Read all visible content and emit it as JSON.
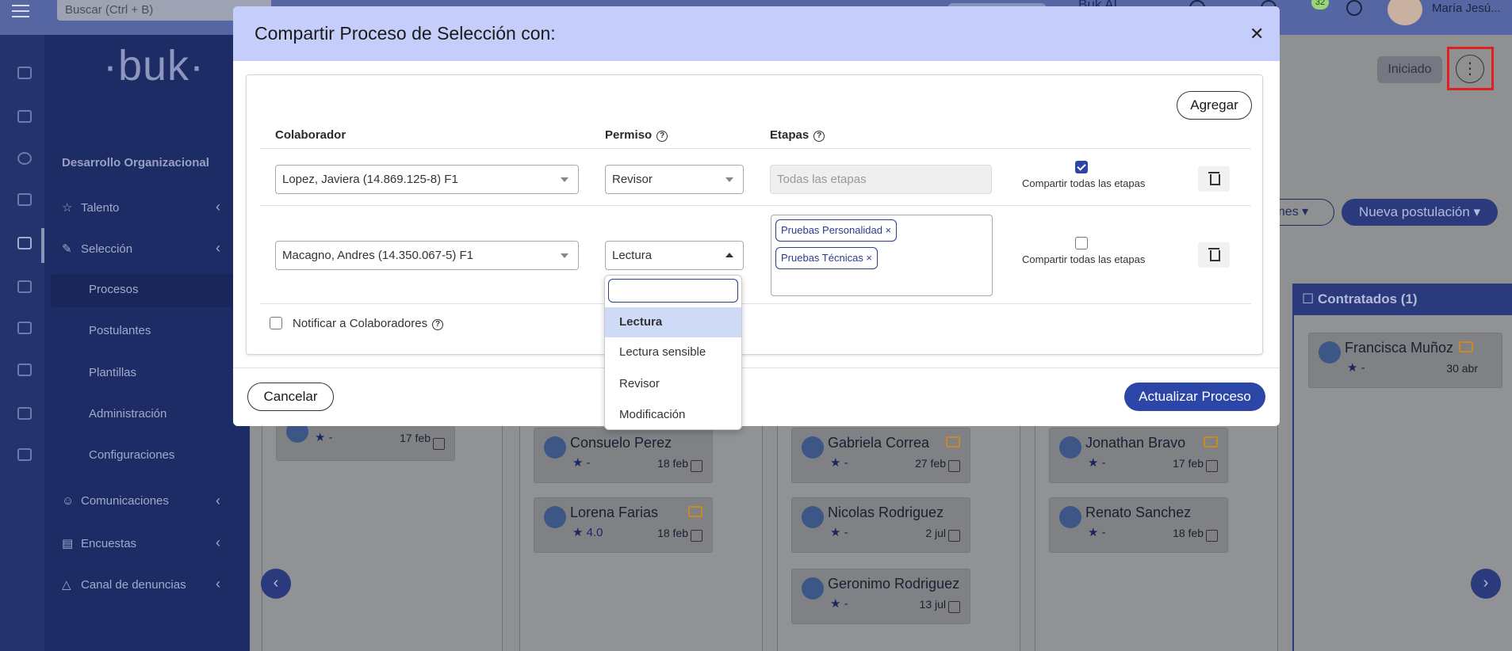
{
  "topbar": {
    "search_placeholder": "Buscar (Ctrl + B)",
    "bukai": "Buk AI",
    "notif_count": "32",
    "user_name": "María Jesú..."
  },
  "sidebar": {
    "logo": "·buk·",
    "org": "Desarrollo Organizacional",
    "items": [
      {
        "label": "Talento",
        "icon": "star-icon"
      },
      {
        "label": "Selección",
        "icon": "person-edit-icon"
      },
      {
        "label": "Comunicaciones",
        "icon": "people-icon"
      },
      {
        "label": "Encuestas",
        "icon": "document-icon"
      },
      {
        "label": "Canal de denuncias",
        "icon": "warning-icon"
      }
    ],
    "sub_items": [
      "Procesos",
      "Postulantes",
      "Plantillas",
      "Administración",
      "Configuraciones"
    ]
  },
  "background": {
    "status": "Iniciado",
    "postulaciones_btn": "ones",
    "nueva_btn": "Nueva postulación",
    "contratados_header": "Contratados (1)",
    "cards": [
      {
        "name": "",
        "stars": "-",
        "date": "17 feb"
      },
      {
        "name": "Consuelo Perez",
        "stars": "-",
        "date": "18 feb"
      },
      {
        "name": "Lorena Farias",
        "stars": "4.0",
        "date": "18 feb"
      },
      {
        "name": "Gabriela Correa",
        "stars": "-",
        "date": "27 feb"
      },
      {
        "name": "Nicolas Rodriguez",
        "stars": "-",
        "date": "2 jul"
      },
      {
        "name": "Geronimo Rodriguez",
        "stars": "-",
        "date": "13 jul"
      },
      {
        "name": "Jonathan Bravo",
        "stars": "-",
        "date": "17 feb"
      },
      {
        "name": "Renato Sanchez",
        "stars": "-",
        "date": "18 feb"
      },
      {
        "name": "Francisca Muñoz",
        "stars": "-",
        "date": "30 abr"
      }
    ]
  },
  "modal": {
    "title": "Compartir Proceso de Selección con:",
    "add_button": "Agregar",
    "headers": {
      "colaborador": "Colaborador",
      "permiso": "Permiso",
      "etapas": "Etapas"
    },
    "rows": [
      {
        "colaborador": "Lopez, Javiera (14.869.125-8) F1",
        "permiso": "Revisor",
        "etapas_placeholder": "Todas las etapas",
        "share_all_label": "Compartir todas las etapas",
        "share_all": true
      },
      {
        "colaborador": "Macagno, Andres (14.350.067-5) F1",
        "permiso": "Lectura",
        "etapas_tags": [
          "Pruebas Personalidad ×",
          "Pruebas Técnicas ×"
        ],
        "share_all_label": "Compartir todas las etapas",
        "share_all": false
      }
    ],
    "notify_label": "Notificar a Colaboradores",
    "cancel_button": "Cancelar",
    "update_button": "Actualizar Proceso",
    "close_icon": "close-icon"
  },
  "dropdown": {
    "search_value": "",
    "options": [
      "Lectura",
      "Lectura sensible",
      "Revisor",
      "Modificación"
    ],
    "selected": "Lectura"
  },
  "colors": {
    "primary": "#2b46a6",
    "modal_header": "#c5cdfb",
    "sidebar": "#1e2c66"
  }
}
